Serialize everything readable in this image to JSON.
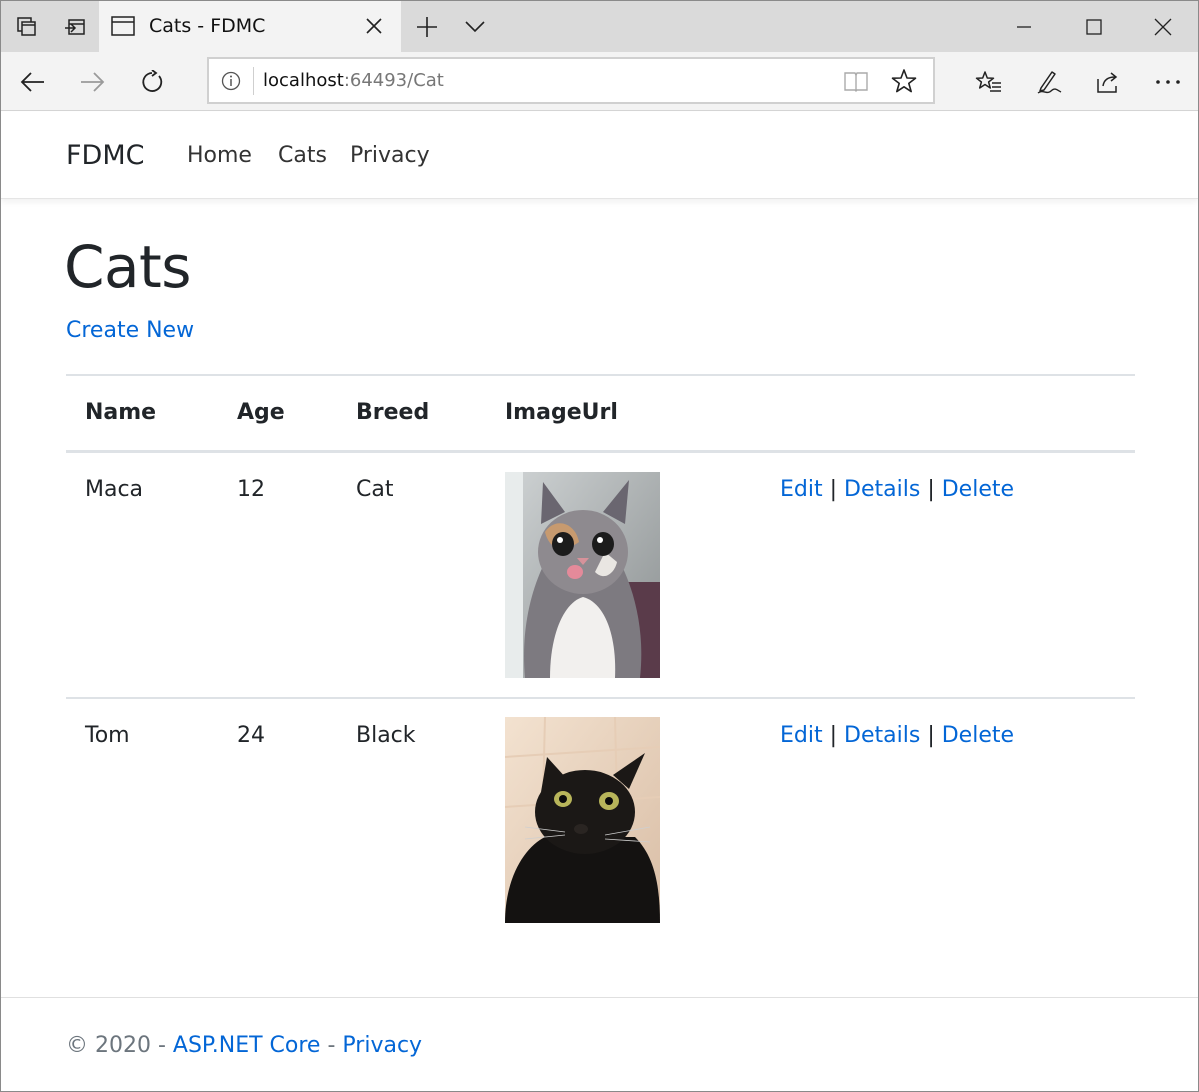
{
  "browser": {
    "tab_title": "Cats - FDMC",
    "url_host": "localhost",
    "url_rest": ":64493/Cat"
  },
  "site": {
    "brand": "FDMC",
    "nav": [
      "Home",
      "Cats",
      "Privacy"
    ]
  },
  "page": {
    "title": "Cats",
    "create_new": "Create New"
  },
  "table": {
    "headers": [
      "Name",
      "Age",
      "Breed",
      "ImageUrl"
    ],
    "rows": [
      {
        "name": "Maca",
        "age": "12",
        "breed": "Cat",
        "image": "cat-photo-calico",
        "actions": [
          "Edit",
          "Details",
          "Delete"
        ]
      },
      {
        "name": "Tom",
        "age": "24",
        "breed": "Black",
        "image": "cat-photo-black",
        "actions": [
          "Edit",
          "Details",
          "Delete"
        ]
      }
    ],
    "separator": "|"
  },
  "footer": {
    "copyright": "© 2020 - ",
    "link1": "ASP.NET Core",
    "dash": " - ",
    "link2": "Privacy"
  },
  "colors": {
    "link": "#0366d6",
    "text": "#212529"
  }
}
